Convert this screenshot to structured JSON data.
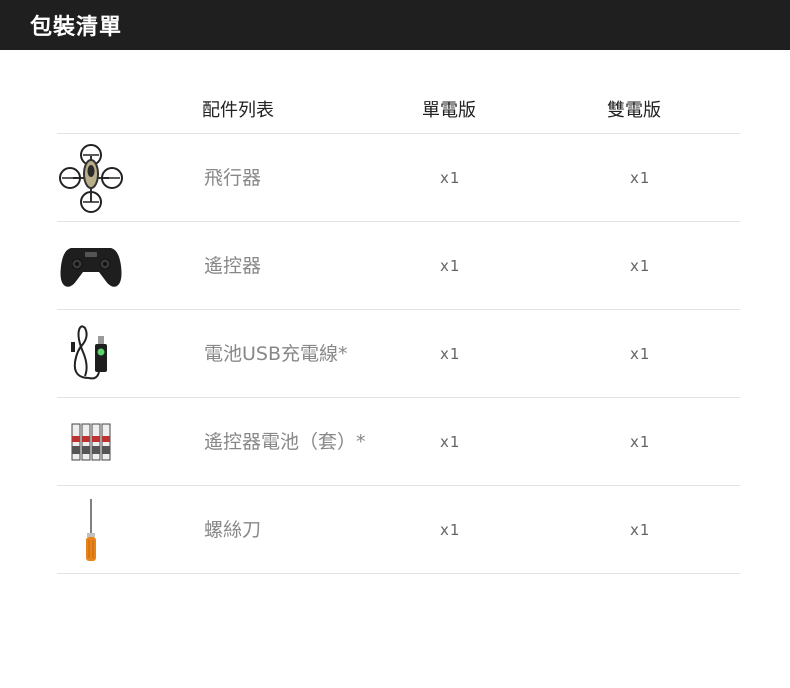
{
  "header": {
    "title": "包裝清單"
  },
  "table": {
    "columns": {
      "item": "配件列表",
      "single": "單電版",
      "double": "雙電版"
    },
    "rows": [
      {
        "icon": "drone-icon",
        "name": "飛行器",
        "single": "x1",
        "double": "x1"
      },
      {
        "icon": "gamepad-controller-icon",
        "name": "遙控器",
        "single": "x1",
        "double": "x1"
      },
      {
        "icon": "usb-charging-cable-icon",
        "name": "電池USB充電線*",
        "single": "x1",
        "double": "x1"
      },
      {
        "icon": "aaa-batteries-icon",
        "name": "遙控器電池（套）*",
        "single": "x1",
        "double": "x1"
      },
      {
        "icon": "screwdriver-icon",
        "name": "螺絲刀",
        "single": "x1",
        "double": "x1"
      }
    ]
  }
}
